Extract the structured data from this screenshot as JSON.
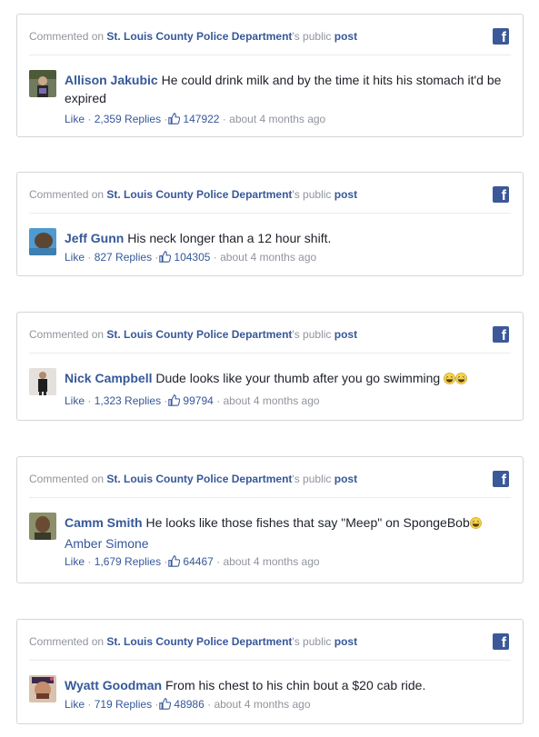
{
  "posts": [
    {
      "header": {
        "prefix": "Commented on ",
        "page": "St. Louis County Police Department",
        "possessive": "'s public ",
        "post_link": "post"
      },
      "author": "Allison Jakubic",
      "text": "He could drink milk and by the time it hits his stomach it'd be expired",
      "meta": {
        "like": "Like",
        "replies": "2,359 Replies",
        "likes": "147922",
        "time": "about 4 months ago"
      }
    },
    {
      "header": {
        "prefix": "Commented on ",
        "page": "St. Louis County Police Department",
        "possessive": "'s public ",
        "post_link": "post"
      },
      "author": "Jeff Gunn",
      "text": "His neck longer than a 12 hour shift.",
      "meta": {
        "like": "Like",
        "replies": "827 Replies",
        "likes": "104305",
        "time": "about 4 months ago"
      }
    },
    {
      "header": {
        "prefix": "Commented on ",
        "page": "St. Louis County Police Department",
        "possessive": "'s public ",
        "post_link": "post"
      },
      "author": "Nick Campbell",
      "text": "Dude looks like your thumb after you go swimming",
      "emoji_count": 2,
      "meta": {
        "like": "Like",
        "replies": "1,323 Replies",
        "likes": "99794",
        "time": "about 4 months ago"
      }
    },
    {
      "header": {
        "prefix": "Commented on ",
        "page": "St. Louis County Police Department",
        "possessive": "'s public ",
        "post_link": "post"
      },
      "author": "Camm Smith",
      "text": "He looks like those fishes that say \"Meep\" on SpongeBob",
      "emoji_count": 1,
      "mention": "Amber Simone",
      "meta": {
        "like": "Like",
        "replies": "1,679 Replies",
        "likes": "64467",
        "time": "about 4 months ago"
      }
    },
    {
      "header": {
        "prefix": "Commented on ",
        "page": "St. Louis County Police Department",
        "possessive": "'s public ",
        "post_link": "post"
      },
      "author": "Wyatt Goodman",
      "text": "From his chest to his chin bout a $20 cab ride.",
      "meta": {
        "like": "Like",
        "replies": "719 Replies",
        "likes": "48986",
        "time": "about 4 months ago"
      }
    }
  ],
  "icons": {
    "platform": "facebook-icon",
    "like": "thumbs-up-icon",
    "emoji": "laughing-face-icon"
  },
  "colors": {
    "link": "#365899",
    "muted": "#90949c",
    "text": "#1d2129",
    "border": "#d3d6db",
    "brand": "#3b5998"
  }
}
